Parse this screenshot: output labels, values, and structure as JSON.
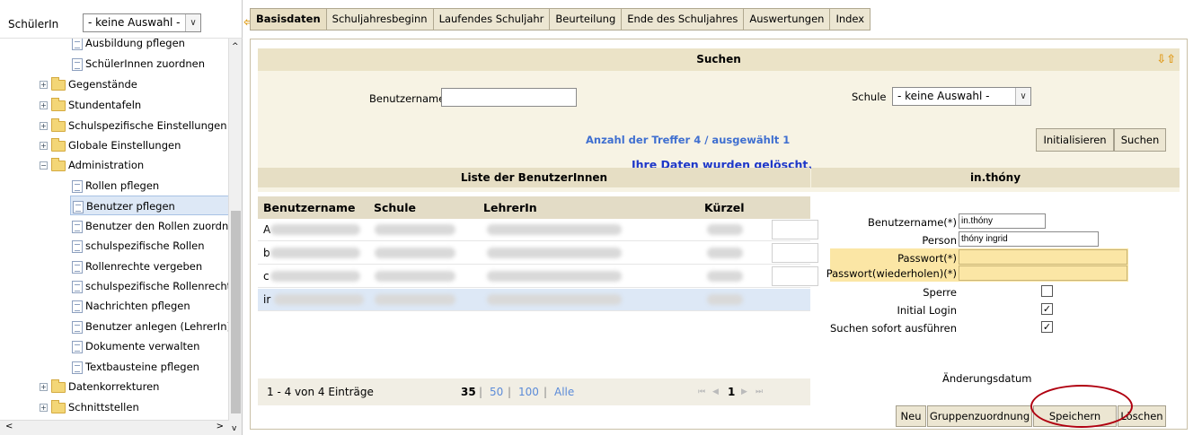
{
  "header": {
    "student_label": "SchülerIn",
    "student_select_value": "- keine Auswahl -",
    "tabs": [
      "Basisdaten",
      "Schuljahresbeginn",
      "Laufendes Schuljahr",
      "Beurteilung",
      "Ende des Schuljahres",
      "Auswertungen",
      "Index"
    ]
  },
  "sidebar": {
    "items": [
      {
        "label": "Ausbildung pflegen",
        "type": "page"
      },
      {
        "label": "SchülerInnen zuordnen",
        "type": "page"
      },
      {
        "label": "Gegenstände",
        "type": "folder"
      },
      {
        "label": "Stundentafeln",
        "type": "folder"
      },
      {
        "label": "Schulspezifische Einstellungen",
        "type": "folder"
      },
      {
        "label": "Globale Einstellungen",
        "type": "folder"
      },
      {
        "label": "Administration",
        "type": "folder-open"
      },
      {
        "label": "Rollen pflegen",
        "type": "page"
      },
      {
        "label": "Benutzer pflegen",
        "type": "page"
      },
      {
        "label": "Benutzer den Rollen zuordne",
        "type": "page"
      },
      {
        "label": "schulspezifische Rollen",
        "type": "page"
      },
      {
        "label": "Rollenrechte vergeben",
        "type": "page"
      },
      {
        "label": "schulspezifische Rollenrechte",
        "type": "page"
      },
      {
        "label": "Nachrichten pflegen",
        "type": "page"
      },
      {
        "label": "Benutzer anlegen (LehrerIn)",
        "type": "page"
      },
      {
        "label": "Dokumente verwalten",
        "type": "page"
      },
      {
        "label": "Textbausteine pflegen",
        "type": "page"
      },
      {
        "label": "Datenkorrekturen",
        "type": "folder"
      },
      {
        "label": "Schnittstellen",
        "type": "folder"
      }
    ]
  },
  "search": {
    "title": "Suchen",
    "username_label": "Benutzername",
    "username_value": "",
    "school_label": "Schule",
    "school_value": "- keine Auswahl -",
    "hits_text": "Anzahl der Treffer  4 / ausgewählt  1",
    "init_button": "Initialisieren",
    "search_button": "Suchen",
    "message": "Ihre Daten wurden gelöscht."
  },
  "list": {
    "title": "Liste der BenutzerInnen",
    "columns": [
      "Benutzername",
      "Schule",
      "LehrerIn",
      "Kürzel"
    ],
    "rows": [
      "A",
      "b",
      "c",
      "ir"
    ],
    "pager_text": "1 - 4 von 4 Einträge",
    "page_sizes": [
      "35",
      "50",
      "100",
      "Alle"
    ],
    "page_current": "1"
  },
  "detail": {
    "title": "in.thóny",
    "username_label": "Benutzername(*)",
    "username_value": "in.thóny",
    "person_label": "Person",
    "person_value": "thóny ingrid",
    "password_label": "Passwort(*)",
    "password_repeat_label": "Passwort(wiederholen)(*)",
    "lock_label": "Sperre",
    "initial_login_label": "Initial Login",
    "search_now_label": "Suchen sofort ausführen",
    "changed_label": "Änderungsdatum",
    "buttons": [
      "Neu",
      "Gruppenzuordnung",
      "Speichern",
      "Löschen"
    ]
  },
  "colors": {
    "tab_bg": "#ece6d2",
    "header_bar": "#ebe3c7",
    "message_blue": "#1d37c8",
    "highlight_circle": "#b00010",
    "password_band": "#fbe6a5"
  }
}
